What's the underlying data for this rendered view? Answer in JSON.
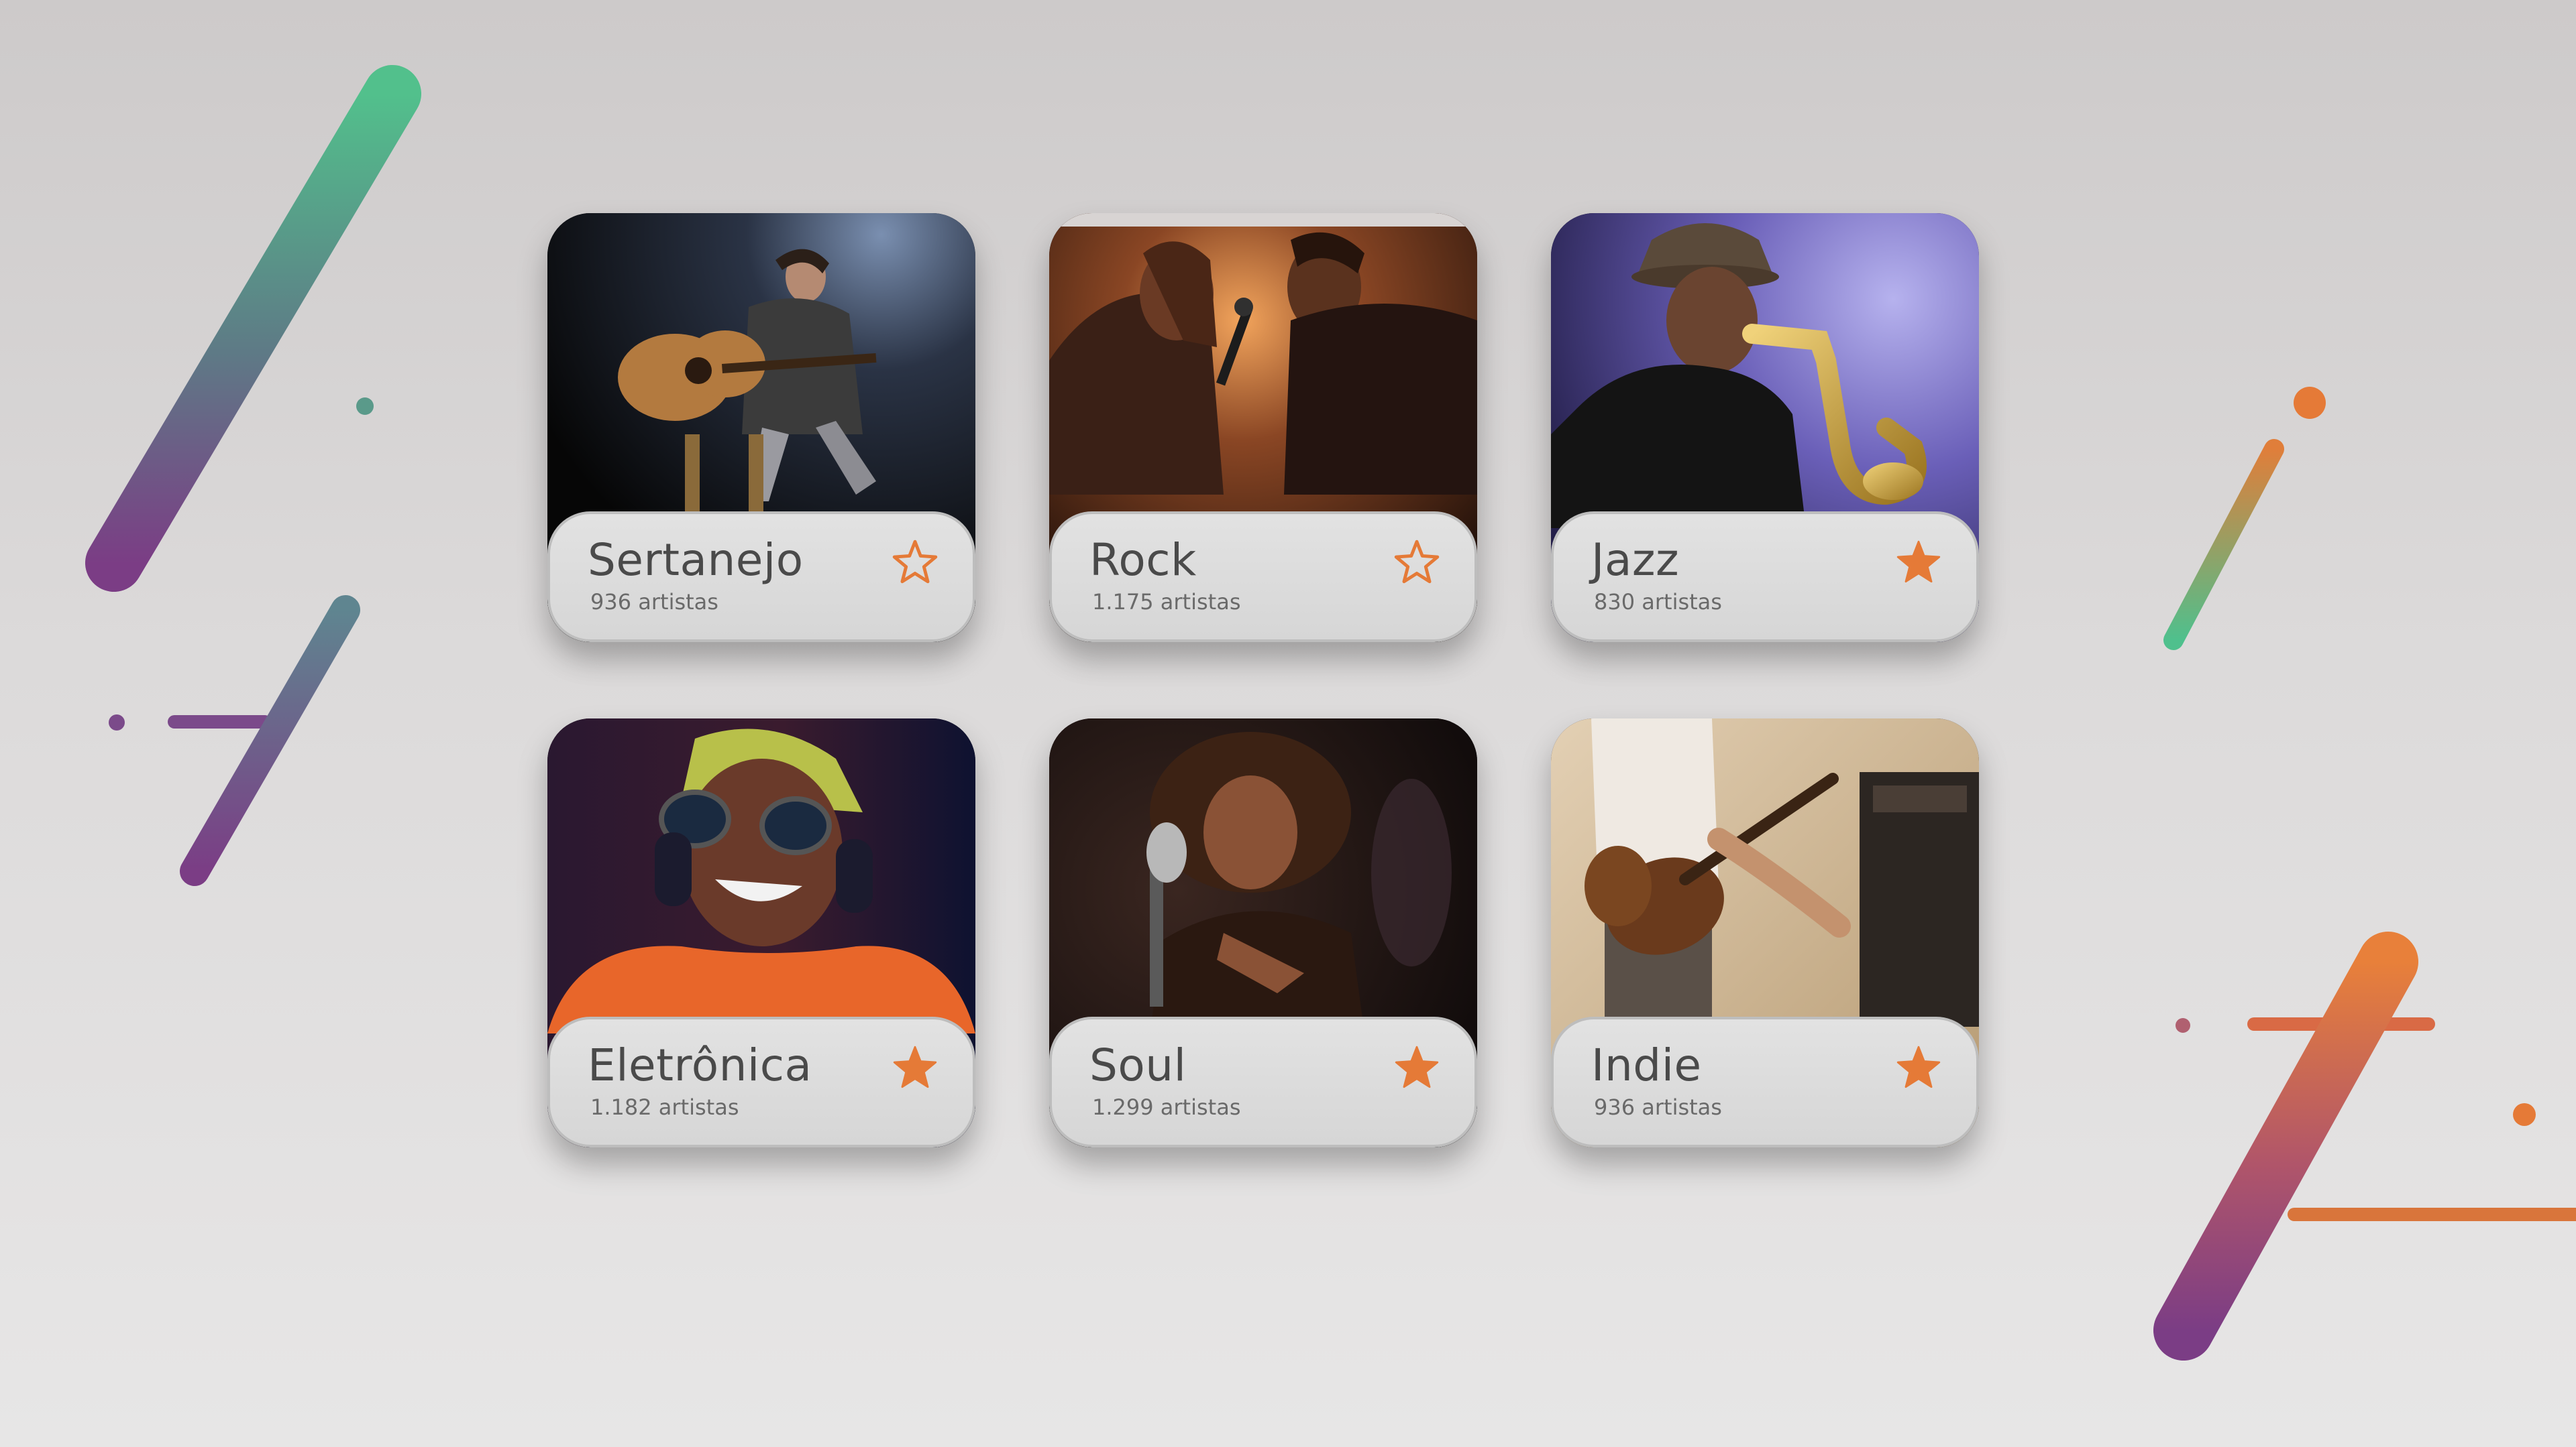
{
  "colors": {
    "accent": "#e57a37",
    "green": "#4fc08d",
    "purple": "#7b3d85",
    "panel": "#dedede",
    "text": "#4a4a4a"
  },
  "genres": [
    {
      "name": "Sertanejo",
      "count": "936 artistas",
      "favorite": false,
      "photo": "acoustic-guitar-player-photo"
    },
    {
      "name": "Rock",
      "count": "1.175 artistas",
      "favorite": false,
      "photo": "rock-singers-photo"
    },
    {
      "name": "Jazz",
      "count": "830 artistas",
      "favorite": true,
      "photo": "saxophone-player-photo"
    },
    {
      "name": "Eletrônica",
      "count": "1.182 artistas",
      "favorite": true,
      "photo": "headphones-listener-photo"
    },
    {
      "name": "Soul",
      "count": "1.299 artistas",
      "favorite": true,
      "photo": "soul-singer-photo"
    },
    {
      "name": "Indie",
      "count": "936 artistas",
      "favorite": true,
      "photo": "electric-guitar-player-photo"
    }
  ]
}
